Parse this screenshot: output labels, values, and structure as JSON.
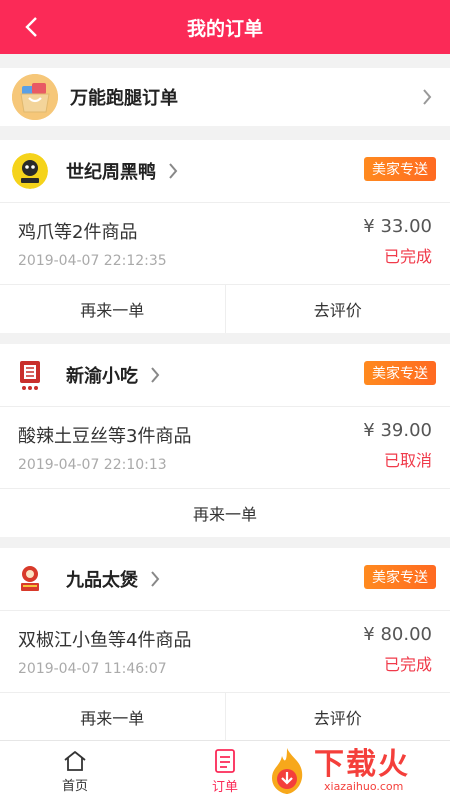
{
  "header": {
    "title": "我的订单"
  },
  "errand": {
    "label": "万能跑腿订单"
  },
  "orders": [
    {
      "shop": "世纪周黑鸭",
      "tag": "美家专送",
      "goods": "鸡爪等2件商品",
      "time": "2019-04-07 22:12:35",
      "price": "¥ 33.00",
      "status": "已完成",
      "actions": [
        "再来一单",
        "去评价"
      ]
    },
    {
      "shop": "新渝小吃",
      "tag": "美家专送",
      "goods": "酸辣土豆丝等3件商品",
      "time": "2019-04-07 22:10:13",
      "price": "¥ 39.00",
      "status": "已取消",
      "actions": [
        "再来一单"
      ]
    },
    {
      "shop": "九品太煲",
      "tag": "美家专送",
      "goods": "双椒江小鱼等4件商品",
      "time": "2019-04-07 11:46:07",
      "price": "¥ 80.00",
      "status": "已完成",
      "actions": [
        "再来一单",
        "去评价"
      ]
    }
  ],
  "tabbar": {
    "home": "首页",
    "order": "订单"
  },
  "watermark": {
    "title": "下载火",
    "sub": "xiazaihuo.com"
  },
  "colors": {
    "accent": "#fb2a57",
    "tag": "#ff7a21",
    "status": "#f03a4a"
  }
}
